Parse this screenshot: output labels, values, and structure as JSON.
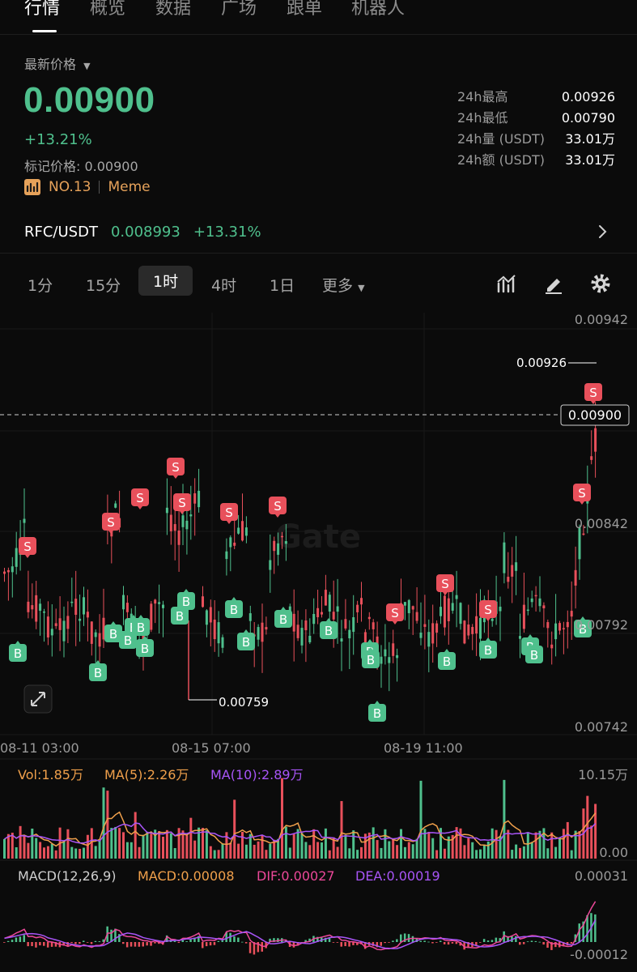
{
  "nav": {
    "tabs": [
      {
        "label": "行情",
        "active": true
      },
      {
        "label": "概览",
        "active": false
      },
      {
        "label": "数据",
        "active": false
      },
      {
        "label": "广场",
        "active": false
      },
      {
        "label": "跟单",
        "active": false
      },
      {
        "label": "机器人",
        "active": false
      }
    ]
  },
  "ticker": {
    "latest_price_label": "最新价格",
    "price": "0.00900",
    "change": "+13.21%",
    "mark_price": "标记价格: 0.00900",
    "rank": "NO.13",
    "category": "Meme",
    "stats": [
      {
        "label": "24h最高",
        "value": "0.00926"
      },
      {
        "label": "24h最低",
        "value": "0.00790"
      },
      {
        "label": "24h量 (USDT)",
        "value": "33.01万"
      },
      {
        "label": "24h额 (USDT)",
        "value": "33.01万"
      }
    ]
  },
  "pair": {
    "name": "RFC/USDT",
    "price": "0.008993",
    "change": "+13.31%"
  },
  "intervals": {
    "items": [
      {
        "label": "1分",
        "active": false
      },
      {
        "label": "15分",
        "active": false
      },
      {
        "label": "1时",
        "active": true
      },
      {
        "label": "4时",
        "active": false
      },
      {
        "label": "1日",
        "active": false
      }
    ],
    "more": "更多"
  },
  "colors": {
    "up": "#4fc08d",
    "down": "#e8505b",
    "ma5": "#f0a04b",
    "ma10": "#a855f7",
    "macd_dif": "#ec4899",
    "macd_dea": "#a855f7"
  },
  "chart_data": {
    "type": "candlestick",
    "watermark": "Gate",
    "price_axis": [
      "0.00942",
      "0.00842",
      "0.00792",
      "0.00742"
    ],
    "ylim": [
      0.00742,
      0.00942
    ],
    "current_price_tag": "0.00900",
    "high_annotation": "0.00926",
    "low_annotation": "0.00759",
    "time_labels": [
      "08-11 03:00",
      "08-15 07:00",
      "08-19 11:00"
    ],
    "trade_markers": {
      "sell": [
        "S",
        "S",
        "S",
        "S",
        "S",
        "S",
        "S",
        "S",
        "S",
        "S",
        "S"
      ],
      "buy": [
        "B",
        "B",
        "B",
        "B",
        "B",
        "B",
        "B",
        "B",
        "B",
        "B",
        "B",
        "B",
        "B",
        "B",
        "B",
        "B",
        "B",
        "B"
      ]
    },
    "volume": {
      "vol_label": "Vol:1.85万",
      "ma5_label": "MA(5):2.26万",
      "ma10_label": "MA(10):2.89万",
      "axis_max": "10.15万",
      "axis_min": "0.00"
    },
    "macd": {
      "params_label": "MACD(12,26,9)",
      "macd_label": "MACD:0.00008",
      "dif_label": "DIF:0.00027",
      "dea_label": "DEA:0.00019",
      "axis_max": "0.00031",
      "axis_min": "-0.00012"
    }
  }
}
